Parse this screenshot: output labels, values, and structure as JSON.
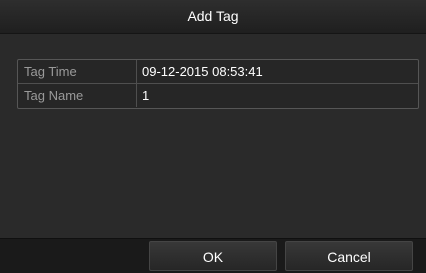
{
  "dialog": {
    "title": "Add Tag"
  },
  "form": {
    "tag_time": {
      "label": "Tag Time",
      "value": "09-12-2015 08:53:41"
    },
    "tag_name": {
      "label": "Tag Name",
      "value": "1"
    }
  },
  "buttons": {
    "ok_label": "OK",
    "cancel_label": "Cancel"
  }
}
